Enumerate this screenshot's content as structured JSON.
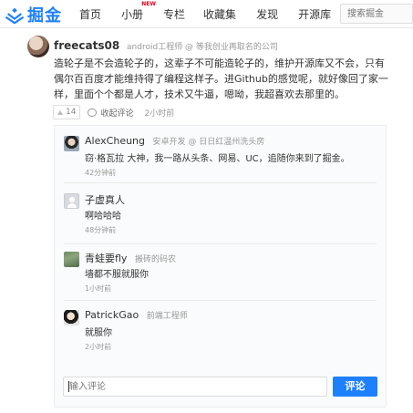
{
  "header": {
    "brand": "掘金",
    "nav": [
      {
        "label": "首页"
      },
      {
        "label": "小册",
        "badge": "NEW"
      },
      {
        "label": "专栏"
      },
      {
        "label": "收藏集"
      },
      {
        "label": "发现"
      },
      {
        "label": "开源库"
      }
    ],
    "search_placeholder": "搜索掘金"
  },
  "post": {
    "author": "freecats08",
    "meta": "android工程师 @ 等我创业再取名的公司",
    "content": "造轮子是不会造轮子的，这辈子不可能造轮子的，维护开源库又不会，只有偶尔百百度才能维持得了编程这样子。进Github的感觉呢，就好像回了家一样，里面个个都是人才，技术又牛逼，嗯呦，我超喜欢去那里的。",
    "likes": "14",
    "collapse_label": "收起评论",
    "time": "2小时前"
  },
  "replies": [
    {
      "name": "AlexCheung",
      "role": "安卓开发 @ 日日红温州洗头房",
      "text": "窃·格瓦拉 大神，我一路从头条、网易、UC，追随你来到了掘金。",
      "time": "42分钟前"
    },
    {
      "name": "子虚真人",
      "role": "",
      "text": "啊哈哈哈",
      "time": "48分钟前"
    },
    {
      "name": "青蛙要fly",
      "role": "搬砖的码农",
      "text": "墙都不服就服你",
      "time": "1小时前"
    },
    {
      "name": "PatrickGao",
      "role": "前端工程师",
      "text": "就服你",
      "time": "2小时前"
    }
  ],
  "comment_input": {
    "placeholder": "输入评论",
    "submit_label": "评论"
  },
  "colors": {
    "brand": "#1e80ff",
    "new_badge": "#e8001c"
  }
}
